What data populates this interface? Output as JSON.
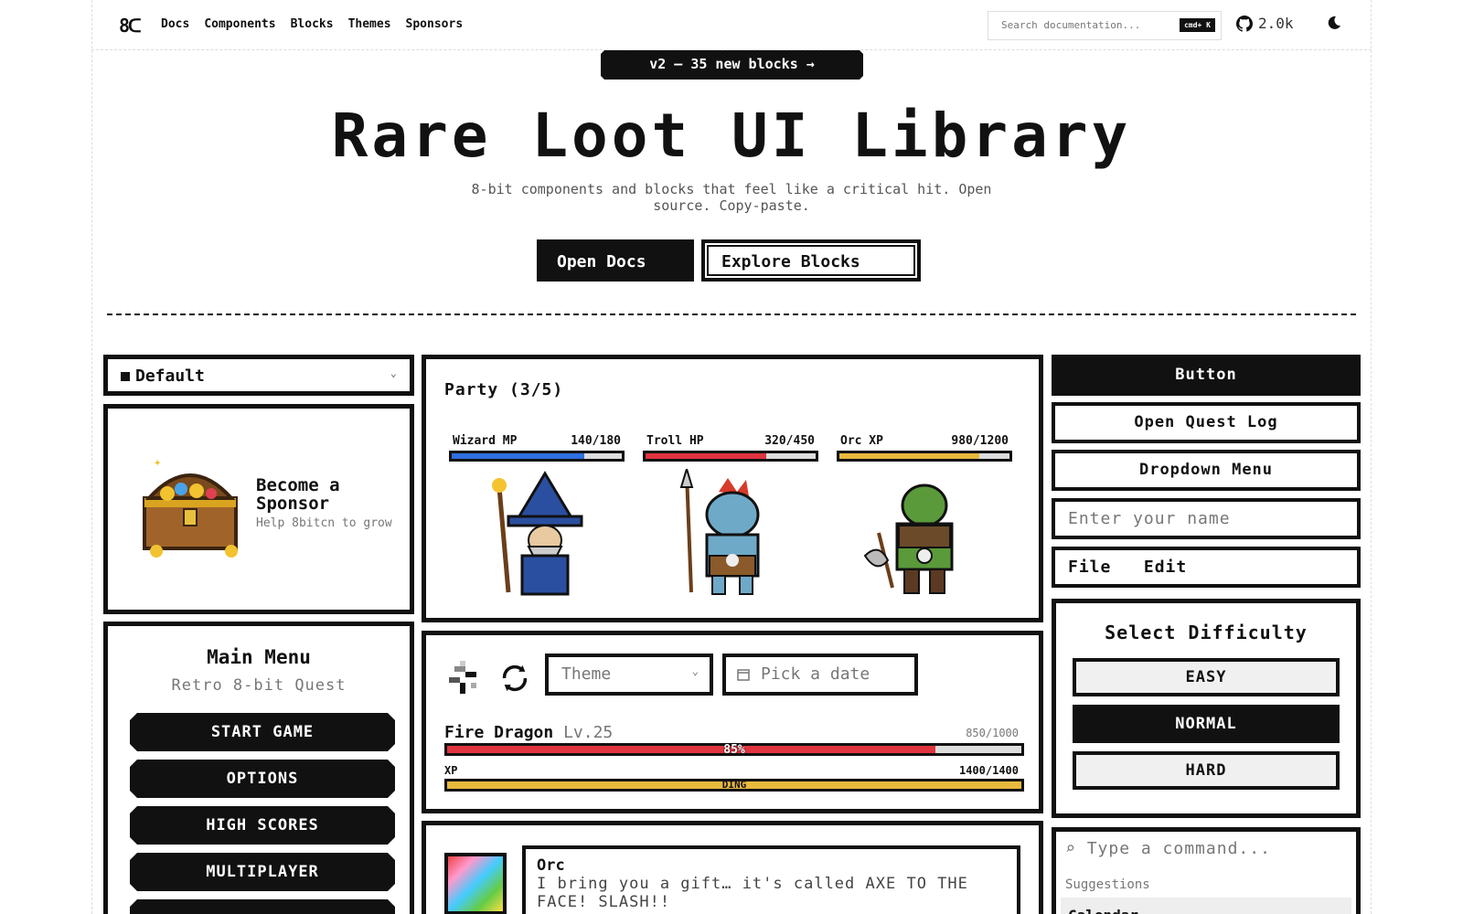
{
  "nav": {
    "logo": "8bitcn",
    "links": [
      "Docs",
      "Components",
      "Blocks",
      "Themes",
      "Sponsors"
    ],
    "search_placeholder": "Search documentation...",
    "search_kbd": "cmd+ K",
    "stars": "2.0k"
  },
  "hero": {
    "badge": "v2 — 35 new blocks →",
    "title": "Rare Loot UI Library",
    "subtitle": "8-bit components and blocks that feel like a critical hit. Open source. Copy-paste.",
    "primary_btn": "Open Docs",
    "secondary_btn": "Explore Blocks"
  },
  "theme_select": {
    "value": "Default"
  },
  "sponsor": {
    "title": "Become a Sponsor",
    "subtitle": "Help 8bitcn to grow"
  },
  "main_menu": {
    "title": "Main Menu",
    "subtitle": "Retro 8-bit Quest",
    "items": [
      "START GAME",
      "OPTIONS",
      "HIGH SCORES",
      "MULTIPLAYER"
    ]
  },
  "party": {
    "title": "Party (3/5)",
    "members": [
      {
        "label": "Wizard MP",
        "value": "140/180",
        "fraction": 0.78,
        "color": "#2f6fe0"
      },
      {
        "label": "Troll HP",
        "value": "320/450",
        "fraction": 0.71,
        "color": "#e0343f"
      },
      {
        "label": "Orc XP",
        "value": "980/1200",
        "fraction": 0.82,
        "color": "#e9b93d"
      }
    ]
  },
  "dragon_panel": {
    "theme_placeholder": "Theme",
    "date_placeholder": "Pick a date",
    "name": "Fire Dragon",
    "level": "Lv.25",
    "hp": "850/1000",
    "hp_percent_label": "85%",
    "hp_fraction": 0.85,
    "xp_label": "XP",
    "xp_value": "1400/1400",
    "xp_bar_label": "DING"
  },
  "chat": {
    "name": "Orc",
    "text": "I bring you a gift… it's called AXE TO THE FACE! SLASH!!"
  },
  "right": {
    "button": "Button",
    "quest_log": "Open Quest Log",
    "dropdown": "Dropdown Menu",
    "name_placeholder": "Enter your name",
    "menubar": [
      "File",
      "Edit"
    ],
    "difficulty_title": "Select Difficulty",
    "difficulties": [
      "EASY",
      "NORMAL",
      "HARD"
    ],
    "command_placeholder": "Type a command...",
    "suggestions_label": "Suggestions",
    "suggestion_first": "Calendar"
  },
  "colors": {
    "accent": "#111111",
    "hp": "#e0343f",
    "mp": "#2f6fe0",
    "xp": "#e9b93d"
  }
}
